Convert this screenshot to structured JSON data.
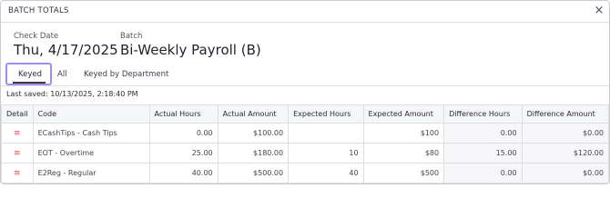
{
  "dialog": {
    "title": "BATCH TOTALS",
    "close_icon": "×"
  },
  "check_date": {
    "label": "Check Date",
    "value": "Thu, 4/17/2025"
  },
  "batch": {
    "label": "Batch",
    "value": "Bi-Weekly Payroll (B)"
  },
  "tabs": [
    {
      "label": "Keyed",
      "active": true
    },
    {
      "label": "All",
      "active": false
    },
    {
      "label": "Keyed by Department",
      "active": false
    }
  ],
  "last_saved": "Last saved: 10/13/2025, 2:18:40 PM",
  "table": {
    "columns": [
      "Detail",
      "Code",
      "Actual Hours",
      "Actual Amount",
      "Expected Hours",
      "Expected Amount",
      "Difference Hours",
      "Difference Amount"
    ],
    "rows": [
      {
        "icon": "≡",
        "code": "ECashTips - Cash Tips",
        "actual_hours": "0.00",
        "actual_amount": "$100.00",
        "expected_hours": "",
        "expected_amount": "$100",
        "difference_hours": "0.00",
        "difference_amount": "$0.00"
      },
      {
        "icon": "≡",
        "code": "EOT - Overtime",
        "actual_hours": "25.00",
        "actual_amount": "$180.00",
        "expected_hours": "10",
        "expected_amount": "$80",
        "difference_hours": "15.00",
        "difference_amount": "$120.00"
      },
      {
        "icon": "≡",
        "code": "E2Reg - Regular",
        "actual_hours": "40.00",
        "actual_amount": "$500.00",
        "expected_hours": "40",
        "expected_amount": "$500",
        "difference_hours": "0.00",
        "difference_amount": "$0.00"
      }
    ]
  },
  "colors": {
    "accent_outline": "#a58af0",
    "detail_icon": "#e04a58"
  }
}
